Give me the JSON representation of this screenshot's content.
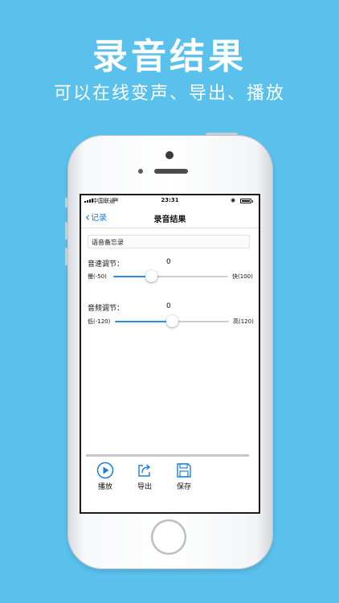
{
  "promo": {
    "title": "录音结果",
    "subtitle": "可以在线变声、导出、播放"
  },
  "status_bar": {
    "carrier": "中国联通",
    "time": "23:31"
  },
  "nav": {
    "back_label": "记录",
    "title": "录音结果"
  },
  "recording": {
    "name_value": "语音备忘录"
  },
  "speed": {
    "label": "音速调节：",
    "value": "0",
    "min_label": "慢(-50)",
    "max_label": "快(100)",
    "min": -50,
    "max": 100,
    "current": 0
  },
  "pitch": {
    "label": "音频调节：",
    "value": "0",
    "min_label": "低(-120)",
    "max_label": "高(120)",
    "min": -120,
    "max": 120,
    "current": 0
  },
  "toolbar": {
    "play_label": "播放",
    "export_label": "导出",
    "save_label": "保存"
  },
  "colors": {
    "background": "#59c1ec",
    "accent": "#1a7ee6",
    "slider_fill": "#2f8fe6"
  },
  "icons": {
    "play": "play-circle-icon",
    "export": "share-export-icon",
    "save": "floppy-disk-icon"
  }
}
